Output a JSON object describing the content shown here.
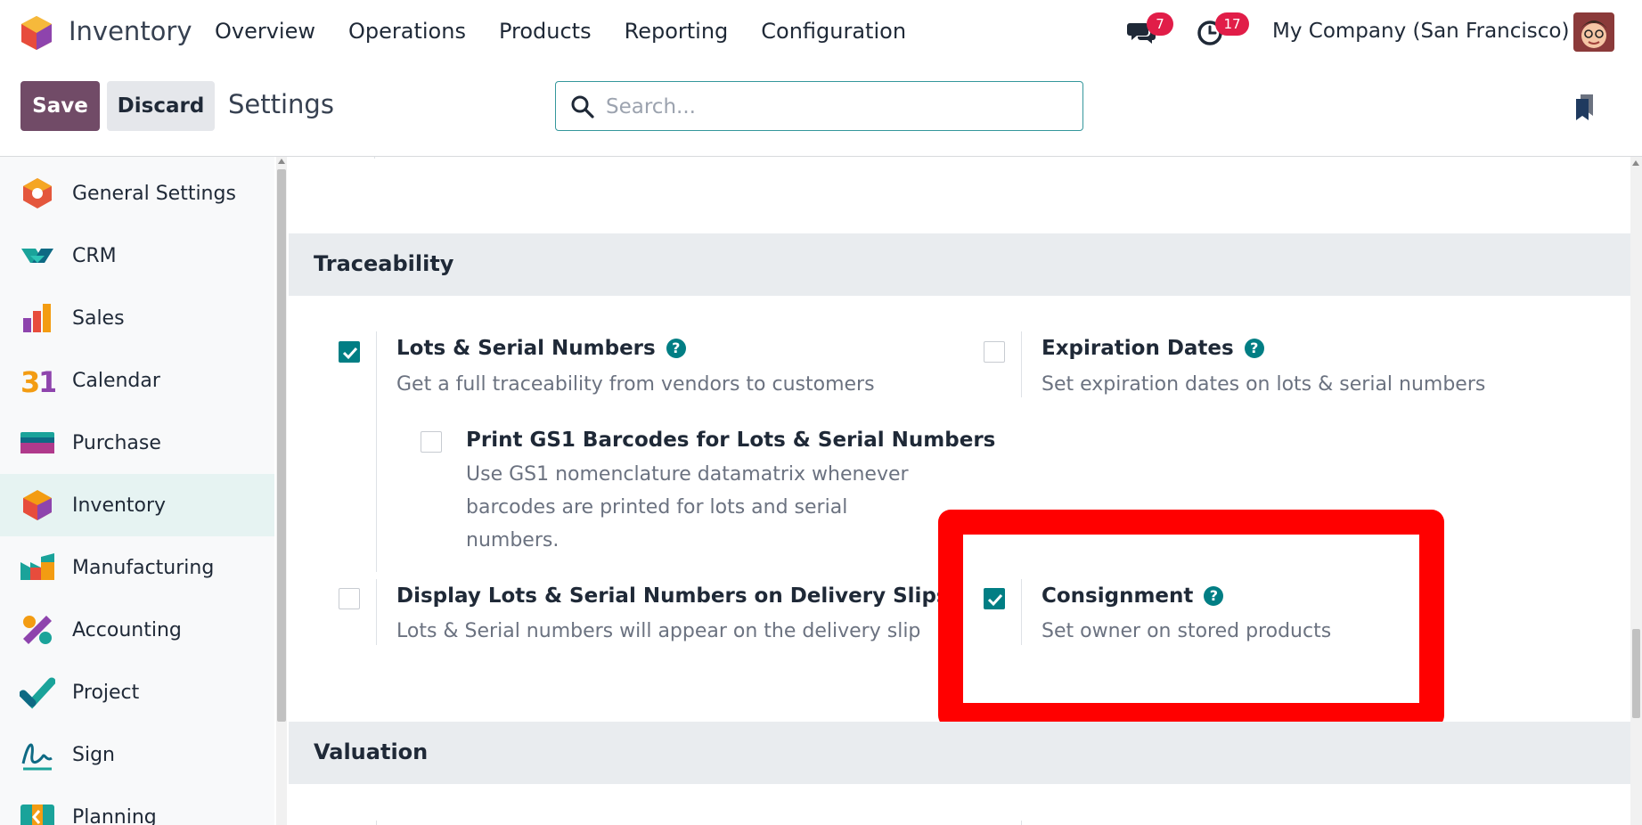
{
  "navbar": {
    "app_name": "Inventory",
    "menu": [
      "Overview",
      "Operations",
      "Products",
      "Reporting",
      "Configuration"
    ],
    "messages_count": "7",
    "activities_count": "17",
    "company": "My Company (San Francisco)"
  },
  "controlbar": {
    "save_label": "Save",
    "discard_label": "Discard",
    "title": "Settings",
    "search_placeholder": "Search..."
  },
  "sidebar": {
    "items": [
      {
        "label": "General Settings",
        "icon": "general-settings-icon"
      },
      {
        "label": "CRM",
        "icon": "crm-icon"
      },
      {
        "label": "Sales",
        "icon": "sales-icon"
      },
      {
        "label": "Calendar",
        "icon": "calendar-icon"
      },
      {
        "label": "Purchase",
        "icon": "purchase-icon"
      },
      {
        "label": "Inventory",
        "icon": "inventory-icon",
        "active": true
      },
      {
        "label": "Manufacturing",
        "icon": "manufacturing-icon"
      },
      {
        "label": "Accounting",
        "icon": "accounting-icon"
      },
      {
        "label": "Project",
        "icon": "project-icon"
      },
      {
        "label": "Sign",
        "icon": "sign-icon"
      },
      {
        "label": "Planning",
        "icon": "planning-icon"
      }
    ]
  },
  "sections": {
    "traceability": {
      "title": "Traceability",
      "settings": {
        "lots": {
          "title": "Lots & Serial Numbers",
          "desc": "Get a full traceability from vendors to customers",
          "checked": true
        },
        "expiration": {
          "title": "Expiration Dates",
          "desc": "Set expiration dates on lots & serial numbers",
          "checked": false
        },
        "gs1": {
          "title": "Print GS1 Barcodes for Lots & Serial Numbers",
          "desc": "Use GS1 nomenclature datamatrix whenever barcodes are printed for lots and serial numbers.",
          "checked": false
        },
        "display_lots": {
          "title": "Display Lots & Serial Numbers on Delivery Slips",
          "desc": "Lots & Serial numbers will appear on the delivery slip",
          "checked": false
        },
        "consignment": {
          "title": "Consignment",
          "desc": "Set owner on stored products",
          "checked": true
        }
      }
    },
    "valuation": {
      "title": "Valuation"
    }
  },
  "colors": {
    "brand": "#714b67",
    "accent": "#017e84",
    "highlight": "#ff0000",
    "badge": "#e11d48"
  }
}
